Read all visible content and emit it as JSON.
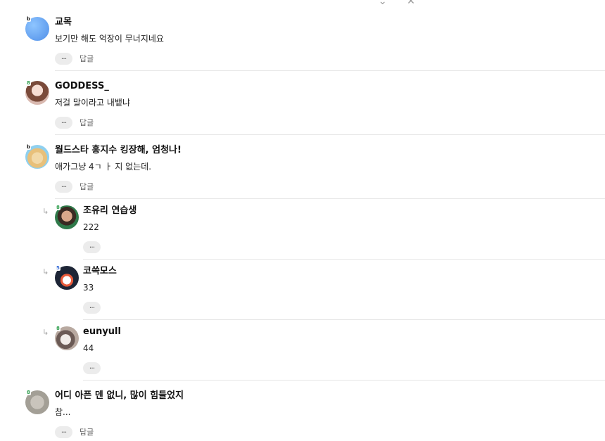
{
  "top_fragment": {
    "left_glyph": "⌄",
    "right_glyph": "✕"
  },
  "actions": {
    "more_label": "···",
    "reply_label": "답글"
  },
  "comments": [
    {
      "nickname": "교목",
      "text": "보기만 해도 억장이 무너지네요",
      "level": "b",
      "avatar": "avatar-blue-circle",
      "is_reply": false,
      "has_reply_button": true
    },
    {
      "nickname": "GODDESS_",
      "text": "저걸 말이라고 내뱉냐",
      "level": "8",
      "avatar": "avatar-photo-woman",
      "is_reply": false,
      "has_reply_button": true
    },
    {
      "nickname": "월드스타 홍지수 킹장해, 엄청나!",
      "text": "애가그냥 4ㄱ ㅏ 지 없는데.",
      "level": "b",
      "avatar": "avatar-photo-dog",
      "is_reply": false,
      "has_reply_button": true
    },
    {
      "nickname": "조유리 연습생",
      "text": "222",
      "level": "8",
      "avatar": "avatar-photo-man",
      "is_reply": true,
      "has_reply_button": false
    },
    {
      "nickname": "코쓱모스",
      "text": "33",
      "level": "5",
      "avatar": "avatar-photo-person",
      "is_reply": true,
      "has_reply_button": false
    },
    {
      "nickname": "eunyull",
      "text": "44",
      "level": "8",
      "avatar": "avatar-photo-cat",
      "is_reply": true,
      "has_reply_button": false
    },
    {
      "nickname": "어디 아픈 덴 없니, 많이 힘들었지",
      "text": "참...",
      "level": "8",
      "avatar": "avatar-gray-leaf",
      "is_reply": false,
      "has_reply_button": true
    }
  ],
  "colors": {
    "divider": "#e6e6e6",
    "pill": "#ececec",
    "text": "#222222"
  }
}
